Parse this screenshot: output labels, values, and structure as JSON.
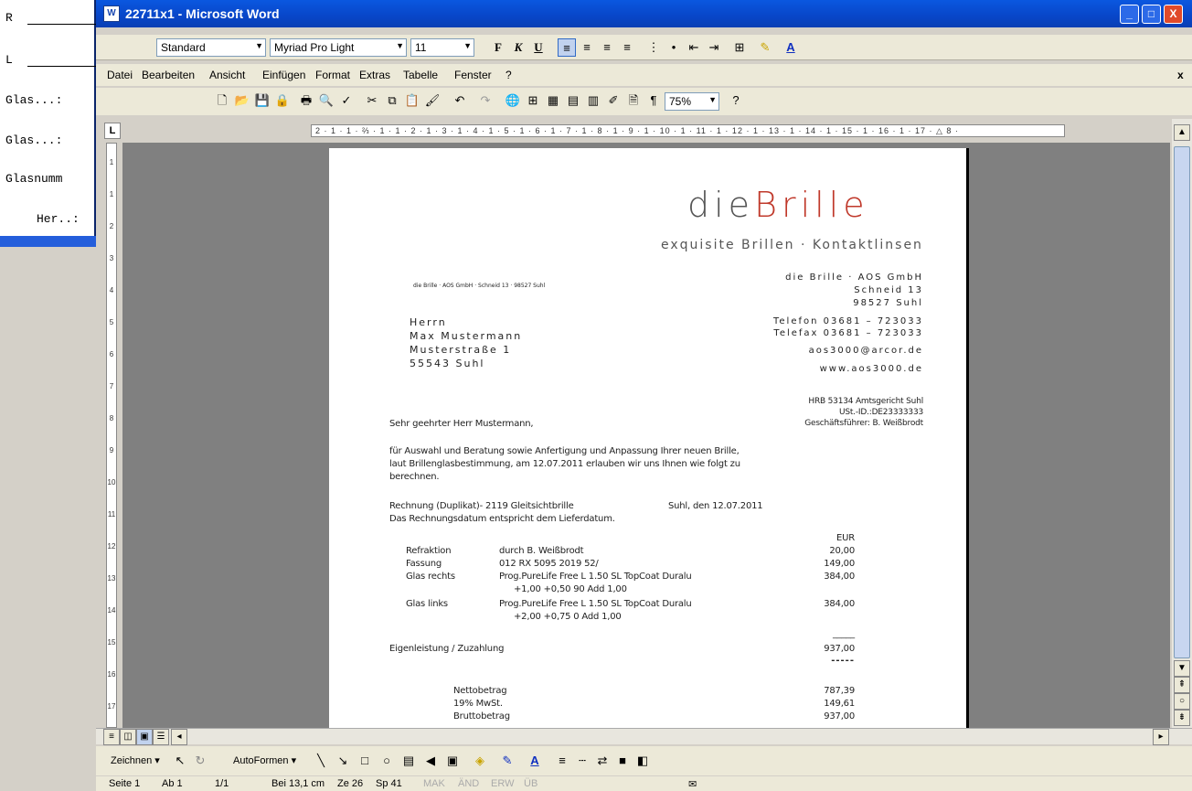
{
  "background_window": {
    "labels": [
      "R",
      "L",
      "Glas...:",
      "Glas...:",
      "Glasnumm",
      "Her..:"
    ]
  },
  "window": {
    "title": "22711x1 - Microsoft Word",
    "controls": {
      "minimize": "_",
      "maximize": "□",
      "close": "X"
    }
  },
  "format_toolbar": {
    "style": "Standard",
    "font": "Myriad Pro Light",
    "size": "11",
    "bold": "F",
    "italic": "K",
    "underline": "U"
  },
  "menu": {
    "items": [
      "Datei",
      "Bearbeiten",
      "Ansicht",
      "Einfügen",
      "Format",
      "Extras",
      "Tabelle",
      "Fenster",
      "?"
    ],
    "close": "x"
  },
  "standard_toolbar": {
    "zoom": "75%"
  },
  "ruler": {
    "h_text": "2 · 1 · 1 · ⅔ · 1 · 1 · 2 · 1 · 3 · 1 · 4 · 1 · 5 · 1 · 6 · 1 · 7 · 1 · 8 · 1 · 9 · 1 · 10 · 1 · 11 · 1 · 12 · 1 · 13 · 1 · 14 · 1 · 15 · 1 · 16 · 1 · 17 · △ 8 ·",
    "corner": "L",
    "v_labels": [
      "1",
      "1",
      "2",
      "3",
      "4",
      "5",
      "6",
      "7",
      "8",
      "9",
      "10",
      "11",
      "12",
      "13",
      "14",
      "15",
      "16",
      "17",
      "8"
    ]
  },
  "letter": {
    "logo_pre": "die",
    "logo_post": "Brille",
    "tagline": "exquisite Brillen · Kontaktlinsen",
    "sender_line": "die Brille · AOS GmbH · Schneid 13 · 98527 Suhl",
    "company": [
      "die Brille · AOS GmbH",
      "Schneid 13",
      "98527 Suhl"
    ],
    "phone": "Telefon 03681 – 723033",
    "fax": "Telefax 03681 – 723033",
    "email": "aos3000@arcor.de",
    "web": "www.aos3000.de",
    "register": [
      "HRB 53134 Amtsgericht Suhl",
      "USt.-ID.:DE23333333",
      "Geschäftsführer: B. Weißbrodt"
    ],
    "recipient": [
      "Herrn",
      "Max Mustermann",
      "Musterstraße 1",
      "55543 Suhl"
    ],
    "salutation": "Sehr geehrter Herr Mustermann,",
    "body": [
      "für Auswahl und Beratung sowie Anfertigung und Anpassung Ihrer neuen Brille,",
      "laut Brillenglasbestimmung, am 12.07.2011 erlauben wir uns Ihnen wie folgt zu",
      "berechnen."
    ],
    "invoice_line": "Rechnung (Duplikat)- 2119  Gleitsichtbrille",
    "date_line": "Suhl, den 12.07.2011",
    "date_note": "Das Rechnungsdatum entspricht dem Lieferdatum.",
    "currency": "EUR",
    "items": [
      {
        "label": "Refraktion",
        "desc": "durch B. Weißbrodt",
        "amount": "20,00"
      },
      {
        "label": "Fassung",
        "desc": "012 RX 5095 2019 52/",
        "amount": "149,00"
      },
      {
        "label": "Glas rechts",
        "desc": "Prog.PureLife Free L 1.50 SL TopCoat Duralu",
        "amount": "384,00"
      },
      {
        "label": "",
        "desc": "+1,00  +0,50  90 Add 1,00",
        "amount": ""
      },
      {
        "label": "Glas links",
        "desc": "Prog.PureLife Free L 1.50 SL TopCoat Duralu",
        "amount": "384,00"
      },
      {
        "label": "",
        "desc": "+2,00  +0,75  0 Add 1,00",
        "amount": ""
      }
    ],
    "underline": "_____",
    "own_label": "Eigenleistung / Zuzahlung",
    "own_amount": "937,00",
    "dashes": "-----",
    "totals": [
      {
        "label": "Nettobetrag",
        "amount": "787,39"
      },
      {
        "label": "19% MwSt.",
        "amount": "149,61"
      },
      {
        "label": "Bruttobetrag",
        "amount": "937,00"
      }
    ]
  },
  "drawing_toolbar": {
    "draw": "Zeichnen ▾",
    "autoshapes": "AutoFormen ▾"
  },
  "status": {
    "page": "Seite 1",
    "section": "Ab 1",
    "count": "1/1",
    "pos": "Bei 13,1 cm",
    "line": "Ze 26",
    "col": "Sp 41",
    "mak": "MAK",
    "and": "ÄND",
    "erw": "ERW",
    "ub": "ÜB"
  }
}
